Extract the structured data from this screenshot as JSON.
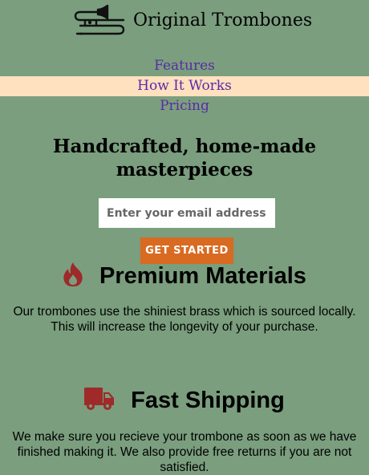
{
  "header": {
    "logo_icon": "trombone-icon",
    "brand": "Original Trombones"
  },
  "nav": {
    "items": [
      {
        "label": "Features",
        "active": false
      },
      {
        "label": "How It Works",
        "active": true
      },
      {
        "label": "Pricing",
        "active": false
      }
    ]
  },
  "hero": {
    "title": "Handcrafted, home-made masterpieces",
    "email_placeholder": "Enter your email address",
    "email_value": "",
    "cta_label": "GET STARTED"
  },
  "features": [
    {
      "icon": "fire-icon",
      "icon_color": "#9e2a2a",
      "title": "Premium Materials",
      "text": "Our trombones use the shiniest brass which is sourced locally. This will increase the longevity of your purchase."
    },
    {
      "icon": "truck-icon",
      "icon_color": "#9e2a2a",
      "title": "Fast Shipping",
      "text": "We make sure you recieve your trombone as soon as we have finished making it. We also provide free returns if you are not satisfied."
    }
  ],
  "colors": {
    "background": "#7a9e7e",
    "nav_link": "#5b2aa5",
    "nav_active_bg": "#ffe0bf",
    "cta_bg": "#d96a21",
    "cta_text": "#ffffff"
  }
}
